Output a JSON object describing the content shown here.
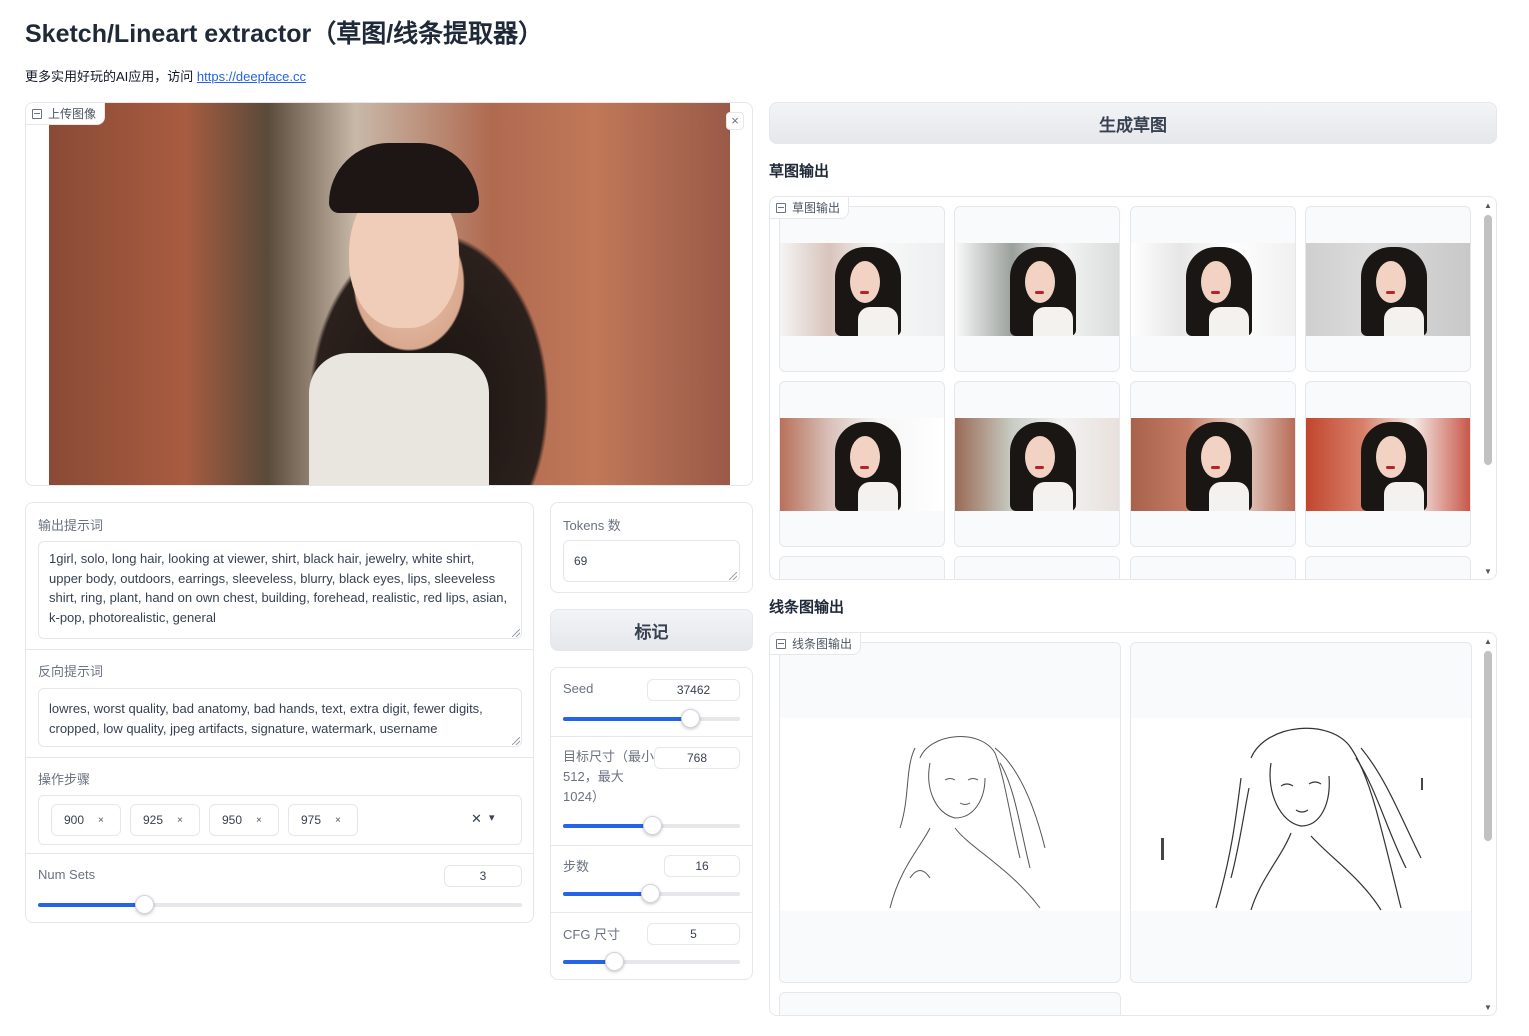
{
  "header": {
    "title": "Sketch/Lineart extractor（草图/线条提取器）",
    "subtitle_prefix": "更多实用好玩的AI应用，访问 ",
    "subtitle_link": "https://deepface.cc"
  },
  "upload": {
    "label": "上传图像",
    "close": "×"
  },
  "prompt": {
    "label": "输出提示词",
    "value": "1girl, solo, long hair, looking at viewer, shirt, black hair, jewelry, white shirt, upper body, outdoors, earrings, sleeveless, blurry, black eyes, lips, sleeveless shirt, ring, plant, hand on own chest, building, forehead, realistic, red lips, asian, k-pop, photorealistic, general"
  },
  "negative": {
    "label": "反向提示词",
    "value": "lowres, worst quality, bad anatomy, bad hands, text, extra digit, fewer digits, cropped, low quality, jpeg artifacts, signature, watermark, username"
  },
  "steps_select": {
    "label": "操作步骤",
    "chips": [
      "900",
      "925",
      "950",
      "975"
    ],
    "remove_glyph": "×",
    "clear_glyph": "✕",
    "dropdown_glyph": "▾"
  },
  "num_sets": {
    "label": "Num Sets",
    "value": "3",
    "fraction": 0.22
  },
  "tokens": {
    "label": "Tokens 数",
    "value": "69"
  },
  "tag_button": {
    "label": "标记"
  },
  "seed": {
    "label": "Seed",
    "value": "37462",
    "fraction": 0.72
  },
  "target_size": {
    "label": "目标尺寸（最小512，最大1024）",
    "value": "768",
    "fraction": 0.5
  },
  "steps": {
    "label": "步数",
    "value": "16",
    "fraction": 0.49
  },
  "cfg": {
    "label": "CFG 尺寸",
    "value": "5",
    "fraction": 0.29
  },
  "generate_button": {
    "label": "生成草图"
  },
  "sketch_output": {
    "section_title": "草图输出",
    "label": "草图输出"
  },
  "lineart_output": {
    "section_title": "线条图输出",
    "label": "线条图输出"
  },
  "colors": {
    "accent": "#2563eb",
    "border": "#e5e7eb",
    "button_bg": "#e5e7eb"
  }
}
